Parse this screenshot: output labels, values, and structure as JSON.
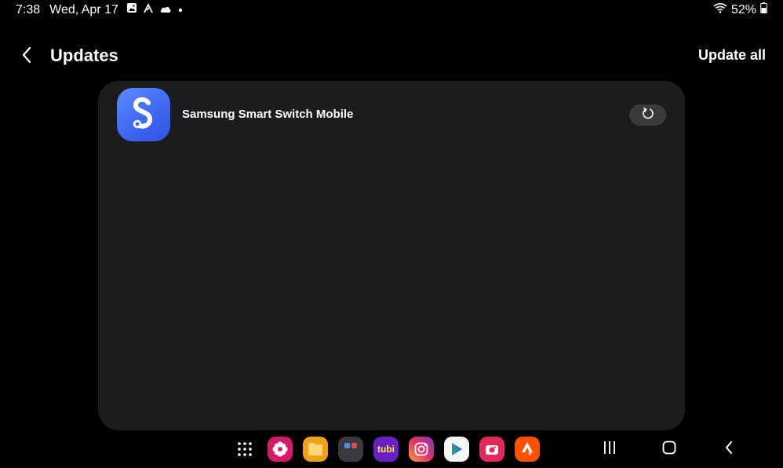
{
  "status_bar": {
    "time": "7:38",
    "date": "Wed, Apr 17",
    "icons": [
      "gallery-icon",
      "strava-notification-icon",
      "cloud-icon",
      "more-dot-icon"
    ],
    "wifi": "wifi-icon",
    "battery_text": "52%",
    "battery_level": 0.52
  },
  "header": {
    "title": "Updates",
    "action_label": "Update all"
  },
  "updates": [
    {
      "app_name": "Samsung Smart Switch Mobile",
      "icon": "smart-switch-icon",
      "action_icon": "retry-icon"
    }
  ],
  "taskbar": {
    "apps": [
      "app-drawer-icon",
      "blossom-app-icon",
      "files-app-icon",
      "app-folder-icon",
      "tubi-app-icon",
      "instagram-app-icon",
      "play-store-icon",
      "camera-app-icon",
      "strava-app-icon"
    ],
    "tubi_label": "tubi",
    "nav": [
      "recent-apps-icon",
      "home-icon",
      "back-icon"
    ]
  },
  "colors": {
    "background": "#000000",
    "card": "#1c1c1e",
    "accent": "#3e66f0"
  }
}
